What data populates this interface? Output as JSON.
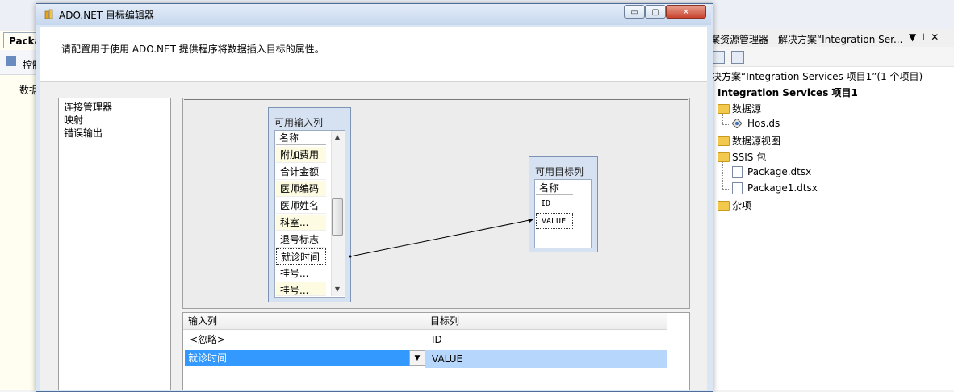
{
  "ide": {
    "tab_label": "Packa",
    "control_flow_label": "控制",
    "data_label": "数据"
  },
  "solution_explorer": {
    "title": "案资源管理器 - 解决方案“Integration Ser...",
    "title_buttons": "▼ ⊥ ✕",
    "tree": {
      "solution": "决方案“Integration Services 项目1”(1 个项目)",
      "project": "Integration Services 项目1",
      "folder_datasources": "数据源",
      "datasource_file": "Hos.ds",
      "folder_dsv": "数据源视图",
      "folder_ssis": "SSIS 包",
      "package_1": "Package.dtsx",
      "package_2": "Package1.dtsx",
      "folder_misc": "杂项"
    }
  },
  "dialog": {
    "title": "ADO.NET 目标编辑器",
    "min_glyph": "▭",
    "max_glyph": "▢",
    "close_glyph": "✕",
    "header": "请配置用于使用 ADO.NET 提供程序将数据插入目标的属性。",
    "nav": [
      "连接管理器",
      "映射",
      "错误输出"
    ],
    "input_columns": {
      "title": "可用输入列",
      "header": "名称",
      "items": [
        "附加费用",
        "合计金额",
        "医师编码",
        "医师姓名",
        "科室...",
        "退号标志",
        "就诊时间",
        "挂号...",
        "挂号..."
      ],
      "selected": "就诊时间",
      "scroll_up": "▲",
      "scroll_down": "▼"
    },
    "output_columns": {
      "title": "可用目标列",
      "header": "名称",
      "items": [
        "ID",
        "VALUE"
      ]
    },
    "grid": {
      "col_input": "输入列",
      "col_output": "目标列",
      "rows": [
        {
          "input": "<忽略>",
          "output": "ID"
        },
        {
          "input": "就诊时间",
          "output": "VALUE"
        }
      ],
      "dropdown_glyph": "▼"
    }
  },
  "colors": {
    "selection": "#3399ff",
    "selection_light": "#b6d7fb",
    "dialog_frame": "#dbe6f4"
  }
}
